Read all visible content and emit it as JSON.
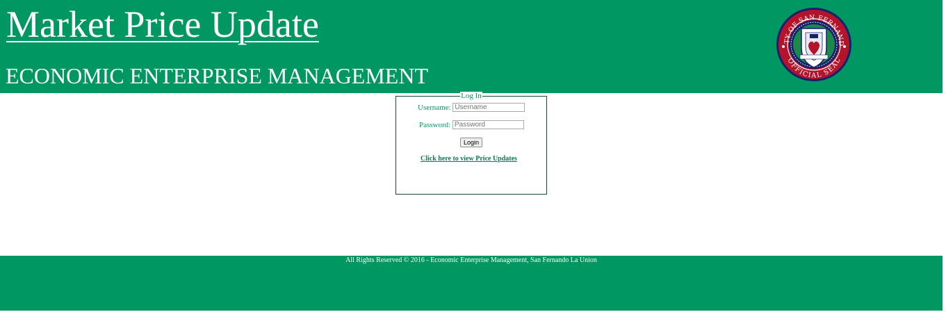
{
  "header": {
    "title": "Market Price Update",
    "subtitle": "ECONOMIC ENTERPRISE MANAGEMENT",
    "seal": {
      "top_text": "CITY OF SAN FERNANDO",
      "bottom_text": "OFFICIAL SEAL"
    }
  },
  "login": {
    "legend": "Log In",
    "username_label": "Username:",
    "username_placeholder": "Username",
    "password_label": "Password:",
    "password_placeholder": "Password",
    "button_label": "Login",
    "view_link": "Click here to view Price Updates"
  },
  "footer": {
    "copyright": "All Rights Reserved © 2016 - Economic Enterprise Management, San Fernando La Union"
  },
  "colors": {
    "brand_green": "#009763",
    "seal_red": "#b3132b",
    "seal_navy": "#15216b"
  }
}
